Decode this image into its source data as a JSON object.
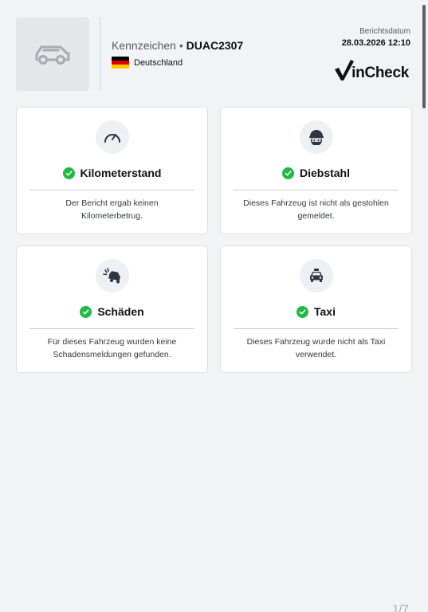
{
  "header": {
    "plate_label": "Kennzeichen",
    "plate_separator": "•",
    "plate_number": "DUAC2307",
    "country": "Deutschland",
    "date_label": "Berichtsdatum",
    "date_value": "28.03.2026 12:10",
    "logo_text": "inCheck",
    "thumb_icon": "car-outline-icon"
  },
  "cards": [
    {
      "title": "Kilometerstand",
      "text": "Der Bericht ergab keinen Kilometerbetrug.",
      "icon": "speedometer-icon"
    },
    {
      "title": "Diebstahl",
      "text": "Dieses Fahrzeug ist nicht als gestohlen gemeldet.",
      "icon": "thief-icon"
    },
    {
      "title": "Schäden",
      "text": "Für dieses Fahrzeug wurden keine Schadensmeldungen gefunden.",
      "icon": "car-crash-icon"
    },
    {
      "title": "Taxi",
      "text": "Dieses Fahrzeug wurde nicht als Taxi verwendet.",
      "icon": "taxi-icon"
    }
  ],
  "footer": {
    "page_indicator": "1/7"
  },
  "colors": {
    "check": "#1fb944",
    "background": "#f2f3f5",
    "card_border": "#dcdfe3"
  }
}
